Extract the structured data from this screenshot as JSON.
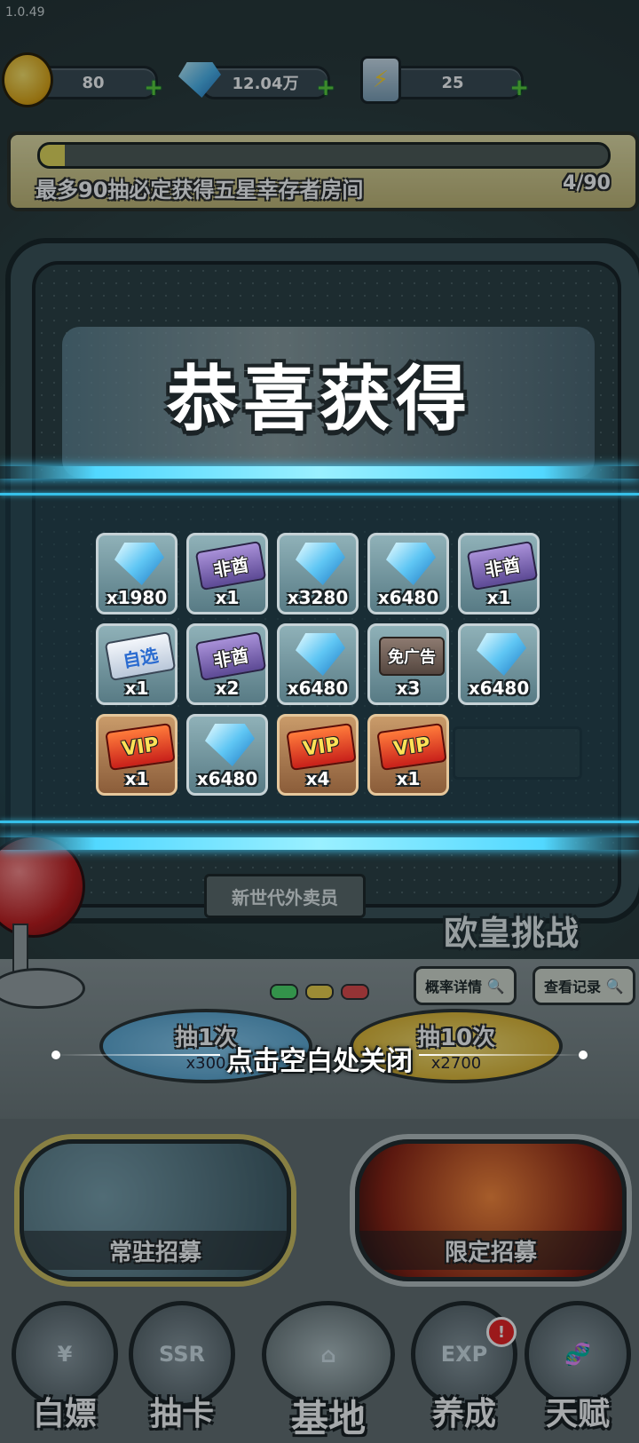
{
  "version": "1.0.49",
  "resources": [
    {
      "name": "coins",
      "value": "80",
      "icon": "coin-icon"
    },
    {
      "name": "gems",
      "value": "12.04万",
      "icon": "gem-icon"
    },
    {
      "name": "energy",
      "value": "25",
      "icon": "battery-icon"
    }
  ],
  "pity": {
    "text": "最多90抽必定获得五星幸存者房间",
    "count": "4/90",
    "progress": 0.044
  },
  "machine": {
    "new_gen_label": "新世代外卖员",
    "challenge_label": "欧皇挑战",
    "prob_button": "概率详情",
    "record_button": "查看记录",
    "draw_one": {
      "label": "抽1次",
      "cost": "x300"
    },
    "draw_ten": {
      "label": "抽10次",
      "cost": "x2700"
    }
  },
  "reward_popup": {
    "title": "恭喜获得",
    "close_hint": "点击空白处关闭",
    "items": [
      {
        "type": "gem",
        "qty": "x1980"
      },
      {
        "type": "ticket-purple",
        "text": "非酋",
        "qty": "x1"
      },
      {
        "type": "gem",
        "qty": "x3280"
      },
      {
        "type": "gem",
        "qty": "x6480"
      },
      {
        "type": "ticket-purple",
        "text": "非酋",
        "qty": "x1"
      },
      {
        "type": "ticket-self",
        "text": "自选",
        "qty": "x1"
      },
      {
        "type": "ticket-purple",
        "text": "非酋",
        "qty": "x2"
      },
      {
        "type": "gem",
        "qty": "x6480"
      },
      {
        "type": "ticket-ad",
        "text": "免广告",
        "qty": "x3"
      },
      {
        "type": "gem",
        "qty": "x6480"
      },
      {
        "type": "vip",
        "text": "VIP",
        "qty": "x1"
      },
      {
        "type": "gem",
        "qty": "x6480"
      },
      {
        "type": "vip",
        "text": "VIP",
        "qty": "x4"
      },
      {
        "type": "vip",
        "text": "VIP",
        "qty": "x1"
      }
    ]
  },
  "recruit": {
    "standard": "常驻招募",
    "limited": "限定招募"
  },
  "nav": [
    {
      "label": "白嫖",
      "icon": "ticket-icon"
    },
    {
      "label": "抽卡",
      "icon": "ssr-icon",
      "icon_text": "SSR"
    },
    {
      "label": "基地",
      "icon": "base-icon",
      "active": true
    },
    {
      "label": "养成",
      "icon": "exp-icon",
      "icon_text": "EXP",
      "badge": "!"
    },
    {
      "label": "天赋",
      "icon": "dna-icon"
    }
  ]
}
